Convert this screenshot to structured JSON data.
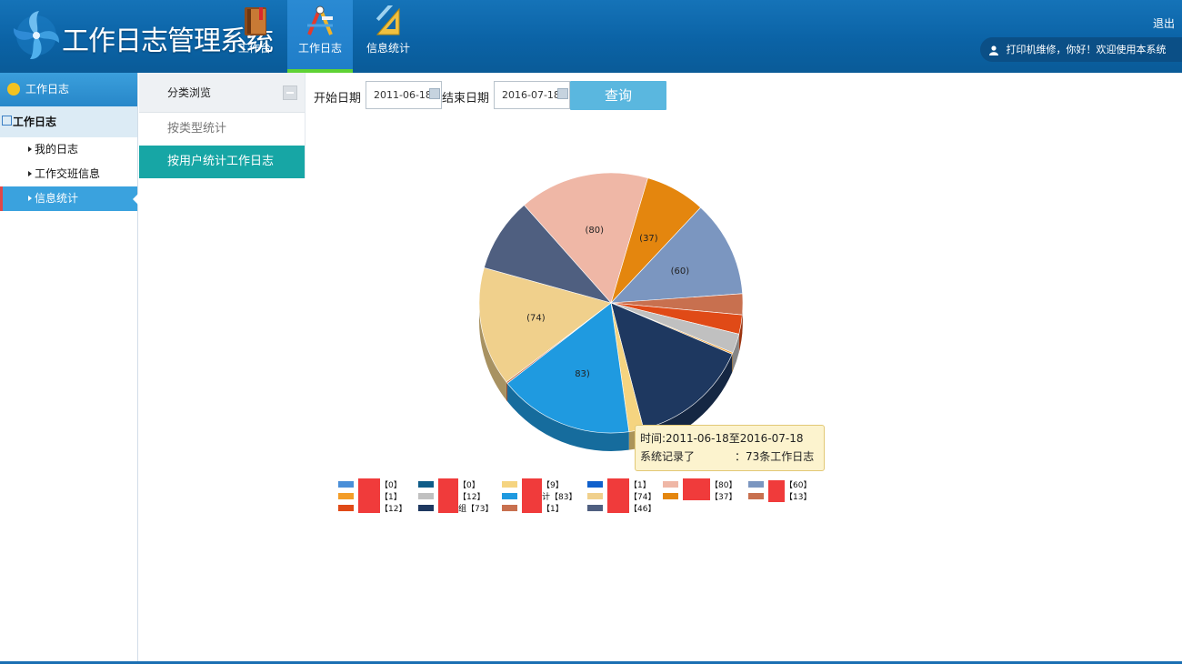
{
  "app": {
    "title": "工作日志管理系统"
  },
  "nav": [
    {
      "label": "工作台",
      "icon": "notebook-icon"
    },
    {
      "label": "工作日志",
      "icon": "compass-tools-icon",
      "active": true
    },
    {
      "label": "信息统计",
      "icon": "triangle-ruler-icon"
    }
  ],
  "header": {
    "logout": "退出",
    "user_greeting": "打印机维修，你好！欢迎使用本系统"
  },
  "sidebar": {
    "header": "工作日志",
    "group": "工作日志",
    "items": [
      {
        "label": "我的日志"
      },
      {
        "label": "工作交班信息"
      },
      {
        "label": "信息统计",
        "active": true
      }
    ]
  },
  "submenu": {
    "header": "分类浏览",
    "items": [
      {
        "label": "按类型统计"
      },
      {
        "label": "按用户统计工作日志",
        "active": true
      }
    ]
  },
  "filter": {
    "start_label": "开始日期",
    "start_value": "2011-06-18",
    "end_label": "结束日期",
    "end_value": "2016-07-18",
    "query_label": "查询"
  },
  "tooltip": {
    "line1": "时间:2011-06-18至2016-07-18",
    "line2": "系统记录了",
    "line2b": "：73条工作日志"
  },
  "colors": {
    "accent": "#17a6a5",
    "header": "#0b63a6",
    "active_nav": "#1f7dc8"
  },
  "chart_data": {
    "type": "pie",
    "values": [
      80,
      37,
      60,
      13,
      12,
      12,
      1,
      73,
      9,
      83,
      1,
      74,
      46
    ],
    "colors": [
      "#efb7a6",
      "#e4860e",
      "#7b96c0",
      "#c8704f",
      "#e04a17",
      "#c0c0c0",
      "#f39d29",
      "#1e3860",
      "#f5d480",
      "#1f9ae0",
      "#c8704f",
      "#f0d08c",
      "#4f5f80"
    ],
    "data_labels": [
      "(80)",
      "(37)",
      "(60)",
      "",
      "",
      "",
      "",
      "",
      "",
      "83)",
      "",
      "(74)",
      ""
    ],
    "legend": [
      {
        "value": "【0】",
        "color": "#4a8fd8"
      },
      {
        "value": "【0】",
        "color": "#0f5c88"
      },
      {
        "value": "【9】",
        "color": "#f5d480"
      },
      {
        "value": "【1】",
        "color": "#1060cc"
      },
      {
        "value": "【80】",
        "color": "#efb7a6"
      },
      {
        "value": "【60】",
        "color": "#7b96c0"
      },
      {
        "value": "【1】",
        "color": "#f39d29"
      },
      {
        "value": "【12】",
        "color": "#c0c0c0"
      },
      {
        "value": "计【83】",
        "color": "#1f9ae0"
      },
      {
        "value": "【74】",
        "color": "#f0d08c"
      },
      {
        "value": "【37】",
        "color": "#e4860e"
      },
      {
        "value": "【13】",
        "color": "#c8704f"
      },
      {
        "value": "【12】",
        "color": "#e04a17"
      },
      {
        "value": "组【73】",
        "color": "#1e3860"
      },
      {
        "value": "【1】",
        "color": "#c8704f"
      },
      {
        "value": "【46】",
        "color": "#4f5f80"
      }
    ]
  }
}
